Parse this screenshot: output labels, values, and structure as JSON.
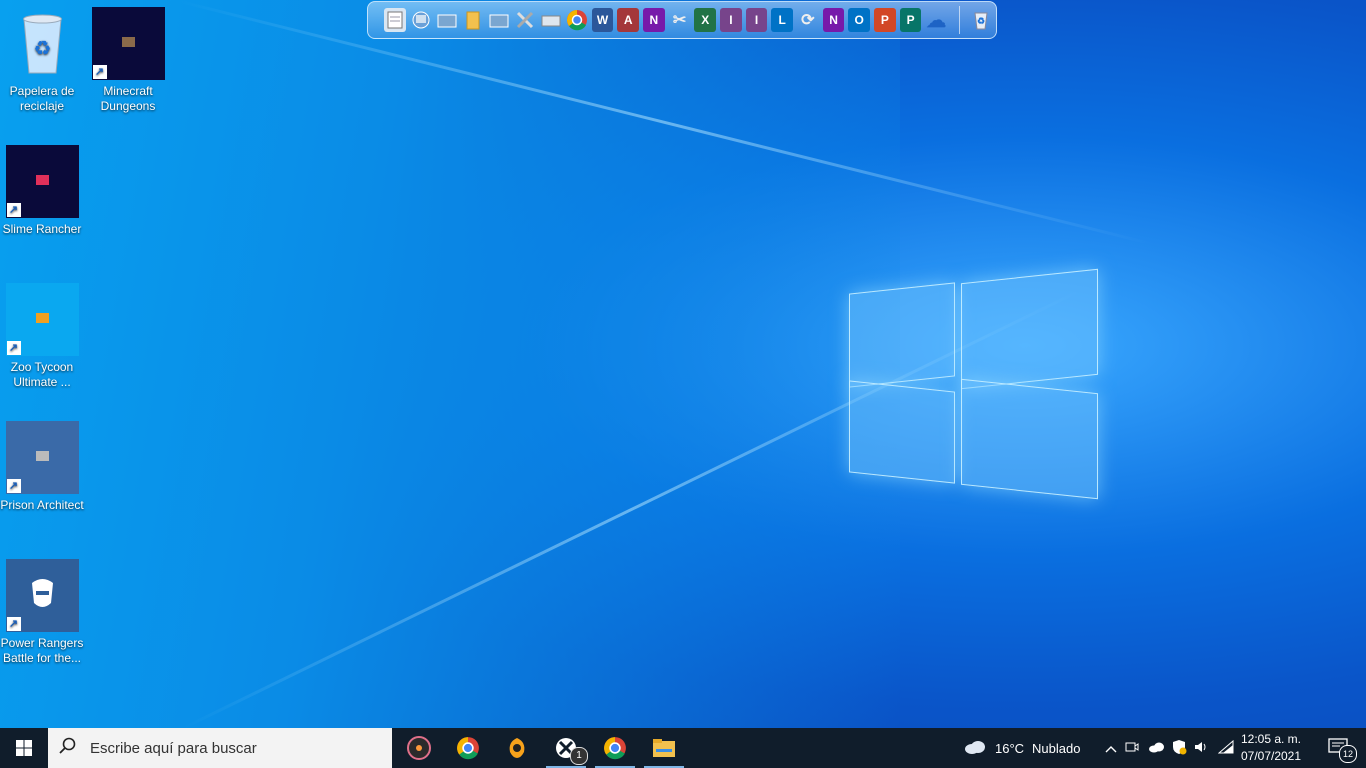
{
  "desktop": {
    "icons": [
      {
        "label": "Papelera de reciclaje",
        "icon": "recycle-bin-icon"
      },
      {
        "label": "Minecraft Dungeons",
        "icon": "minecraft-dungeons-icon"
      },
      {
        "label": "Slime Rancher",
        "icon": "slime-rancher-icon"
      },
      {
        "label": "Zoo Tycoon Ultimate ...",
        "icon": "zoo-tycoon-icon"
      },
      {
        "label": "Prison Architect",
        "icon": "prison-architect-icon"
      },
      {
        "label": "Power Rangers Battle for the...",
        "icon": "power-rangers-icon"
      }
    ]
  },
  "dock": {
    "items": [
      {
        "icon": "notepad-icon",
        "glyph": ""
      },
      {
        "icon": "network-icon",
        "glyph": ""
      },
      {
        "icon": "folder-open-icon",
        "glyph": ""
      },
      {
        "icon": "folder-icon",
        "glyph": ""
      },
      {
        "icon": "folder-open-2-icon",
        "glyph": ""
      },
      {
        "icon": "tools-icon",
        "glyph": ""
      },
      {
        "icon": "scanner-icon",
        "glyph": ""
      },
      {
        "icon": "chrome-icon",
        "glyph": ""
      },
      {
        "icon": "word-icon",
        "glyph": "W",
        "color": "#2b579a"
      },
      {
        "icon": "access-icon",
        "glyph": "A",
        "color": "#a4373a"
      },
      {
        "icon": "onenote-icon",
        "glyph": "N",
        "color": "#7719aa"
      },
      {
        "icon": "snipping-icon",
        "glyph": "✂"
      },
      {
        "icon": "excel-icon",
        "glyph": "X",
        "color": "#217346"
      },
      {
        "icon": "infopath-icon",
        "glyph": "I",
        "color": "#77448b"
      },
      {
        "icon": "infopath-2-icon",
        "glyph": "I",
        "color": "#77448b"
      },
      {
        "icon": "lync-icon",
        "glyph": "L",
        "color": "#0072c6"
      },
      {
        "icon": "sync-icon",
        "glyph": "⟳"
      },
      {
        "icon": "onenote-2-icon",
        "glyph": "N",
        "color": "#7719aa"
      },
      {
        "icon": "outlook-icon",
        "glyph": "O",
        "color": "#0072c6"
      },
      {
        "icon": "powerpoint-icon",
        "glyph": "P",
        "color": "#d24726"
      },
      {
        "icon": "publisher-icon",
        "glyph": "P",
        "color": "#077568"
      },
      {
        "icon": "onedrive-icon",
        "glyph": "☁"
      }
    ],
    "trash_icon": "recycle-bin-icon"
  },
  "taskbar": {
    "search_placeholder": "Escribe aquí para buscar",
    "apps": [
      {
        "icon": "music-player-icon"
      },
      {
        "icon": "chrome-icon"
      },
      {
        "icon": "fl-studio-icon"
      },
      {
        "icon": "xbox-icon",
        "badge": "1"
      },
      {
        "icon": "chrome-icon"
      },
      {
        "icon": "file-explorer-icon"
      }
    ],
    "weather": {
      "temp": "16°C",
      "condition": "Nublado"
    },
    "clock": {
      "time": "12:05 a. m.",
      "date": "07/07/2021"
    },
    "notifications": "12"
  },
  "colors": {
    "taskbar": "#101d2b",
    "wallpaper": "#0a6fe0"
  }
}
